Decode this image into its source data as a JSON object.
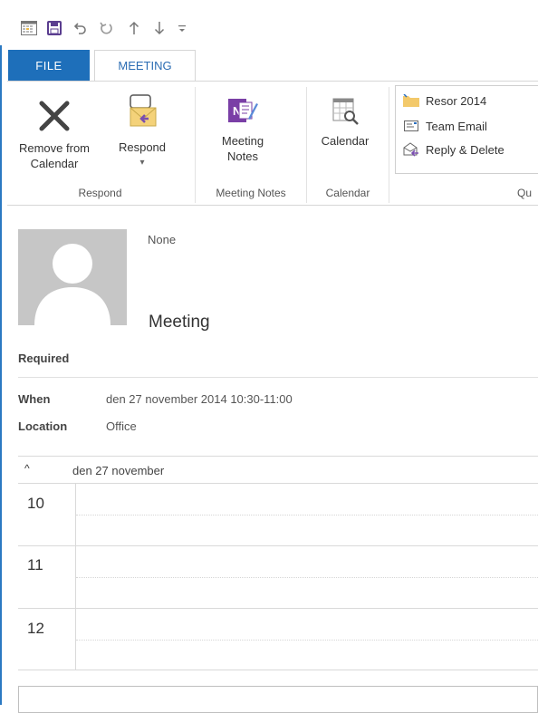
{
  "ribbon": {
    "tabs": [
      {
        "label": "FILE"
      },
      {
        "label": "MEETING"
      }
    ],
    "respond_group": {
      "remove_label_1": "Remove from",
      "remove_label_2": "Calendar",
      "respond_label": "Respond",
      "respond_caret": "▾",
      "group_label": "Respond"
    },
    "notes_group": {
      "label_1": "Meeting",
      "label_2": "Notes",
      "group_label": "Meeting Notes"
    },
    "calendar_group": {
      "label": "Calendar",
      "group_label": "Calendar"
    },
    "quick_steps": {
      "items": [
        {
          "label": "Resor 2014",
          "icon": "folder-icon"
        },
        {
          "label": "Team Email",
          "icon": "team-email-icon"
        },
        {
          "label": "Reply & Delete",
          "icon": "reply-delete-icon"
        }
      ],
      "group_label_partial": "Qu"
    }
  },
  "meeting": {
    "organizer": "None",
    "title": "Meeting",
    "required_label": "Required",
    "when_label": "When",
    "when_value": "den 27 november 2014 10:30-11:00",
    "location_label": "Location",
    "location_value": "Office"
  },
  "calendar_preview": {
    "date_header": "den 27 november",
    "collapse_glyph": "^",
    "hours": [
      "10",
      "11",
      "12"
    ]
  },
  "colors": {
    "accent": "#1e6fba",
    "file_tab": "#1e6fba"
  }
}
